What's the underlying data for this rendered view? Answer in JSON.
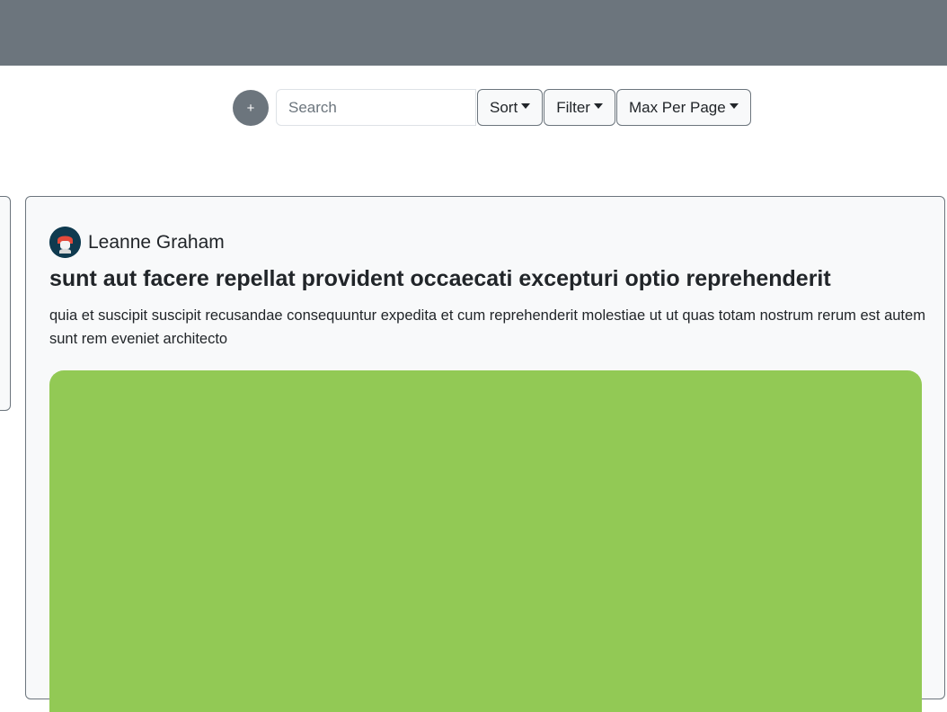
{
  "toolbar": {
    "add_label": "+",
    "search_placeholder": "Search",
    "sort_label": "Sort",
    "filter_label": "Filter",
    "max_per_page_label": "Max Per Page"
  },
  "post": {
    "author": "Leanne Graham",
    "title": "sunt aut facere repellat provident occaecati excepturi optio reprehenderit",
    "body": "quia et suscipit suscipit recusandae consequuntur expedita et cum reprehenderit molestiae ut ut quas totam nostrum rerum est autem sunt rem eveniet architecto",
    "image_color": "#92c955"
  },
  "colors": {
    "topbar": "#6c757d",
    "card_background": "#f8f9fa"
  }
}
